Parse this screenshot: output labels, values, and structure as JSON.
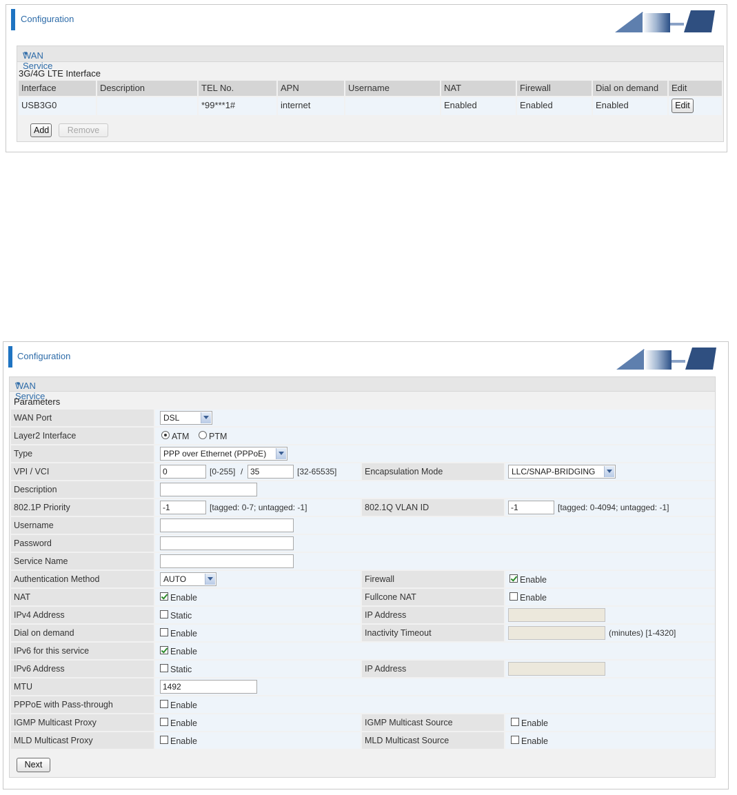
{
  "panel1": {
    "title": "Configuration",
    "wan_title": "WAN Service",
    "subsection": "3G/4G LTE Interface",
    "columns": [
      "Interface",
      "Description",
      "TEL No.",
      "APN",
      "Username",
      "NAT",
      "Firewall",
      "Dial on demand",
      "Edit"
    ],
    "row": {
      "interface": "USB3G0",
      "description": "",
      "tel": "*99***1#",
      "apn": "internet",
      "username": "",
      "nat": "Enabled",
      "firewall": "Enabled",
      "dial": "Enabled",
      "edit": "Edit"
    },
    "add": "Add",
    "remove": "Remove"
  },
  "panel2": {
    "title": "Configuration",
    "wan_title": "WAN Service",
    "parameters": "Parameters",
    "wan_port": {
      "label": "WAN Port",
      "value": "DSL"
    },
    "layer2": {
      "label": "Layer2 Interface",
      "atm": "ATM",
      "ptm": "PTM"
    },
    "type": {
      "label": "Type",
      "value": "PPP over Ethernet (PPPoE)"
    },
    "vpi_vci": {
      "label": "VPI / VCI",
      "vpi": "0",
      "vpi_range": "[0-255]",
      "sep": "/",
      "vci": "35",
      "vci_range": "[32-65535]"
    },
    "encap": {
      "label": "Encapsulation Mode",
      "value": "LLC/SNAP-BRIDGING"
    },
    "description": {
      "label": "Description",
      "value": ""
    },
    "priority": {
      "label": "802.1P Priority",
      "value": "-1",
      "hint": "[tagged: 0-7; untagged: -1]"
    },
    "vlan": {
      "label": "802.1Q VLAN ID",
      "value": "-1",
      "hint": "[tagged: 0-4094; untagged: -1]"
    },
    "username": {
      "label": "Username",
      "value": ""
    },
    "password": {
      "label": "Password",
      "value": ""
    },
    "service_name": {
      "label": "Service Name",
      "value": ""
    },
    "auth": {
      "label": "Authentication Method",
      "value": "AUTO"
    },
    "firewall": {
      "label": "Firewall",
      "opt": "Enable"
    },
    "nat": {
      "label": "NAT",
      "opt": "Enable"
    },
    "fullcone": {
      "label": "Fullcone NAT",
      "opt": "Enable"
    },
    "ipv4": {
      "label": "IPv4 Address",
      "opt": "Static"
    },
    "ip_address_4": {
      "label": "IP Address",
      "value": ""
    },
    "dial": {
      "label": "Dial on demand",
      "opt": "Enable"
    },
    "inactivity": {
      "label": "Inactivity Timeout",
      "value": "",
      "hint": "(minutes)  [1-4320]"
    },
    "ipv6_service": {
      "label": "IPv6 for this service",
      "opt": "Enable"
    },
    "ipv6": {
      "label": "IPv6 Address",
      "opt": "Static"
    },
    "ip_address_6": {
      "label": "IP Address",
      "value": ""
    },
    "mtu": {
      "label": "MTU",
      "value": "1492"
    },
    "pppoe_pass": {
      "label": "PPPoE with Pass-through",
      "opt": "Enable"
    },
    "igmp_proxy": {
      "label": "IGMP Multicast Proxy",
      "opt": "Enable"
    },
    "igmp_source": {
      "label": "IGMP Multicast Source",
      "opt": "Enable"
    },
    "mld_proxy": {
      "label": "MLD Multicast Proxy",
      "opt": "Enable"
    },
    "mld_source": {
      "label": "MLD Multicast Source",
      "opt": "Enable"
    },
    "next": "Next"
  },
  "colors": {
    "accent": "#1f74c2",
    "title_text": "#2d6ba8",
    "row_bg": "#eef4fa",
    "label_bg": "#e4e4e4"
  },
  "icons": {
    "header_logo": "monitor-graphic-icon",
    "collapse": "triangle-down-icon"
  }
}
